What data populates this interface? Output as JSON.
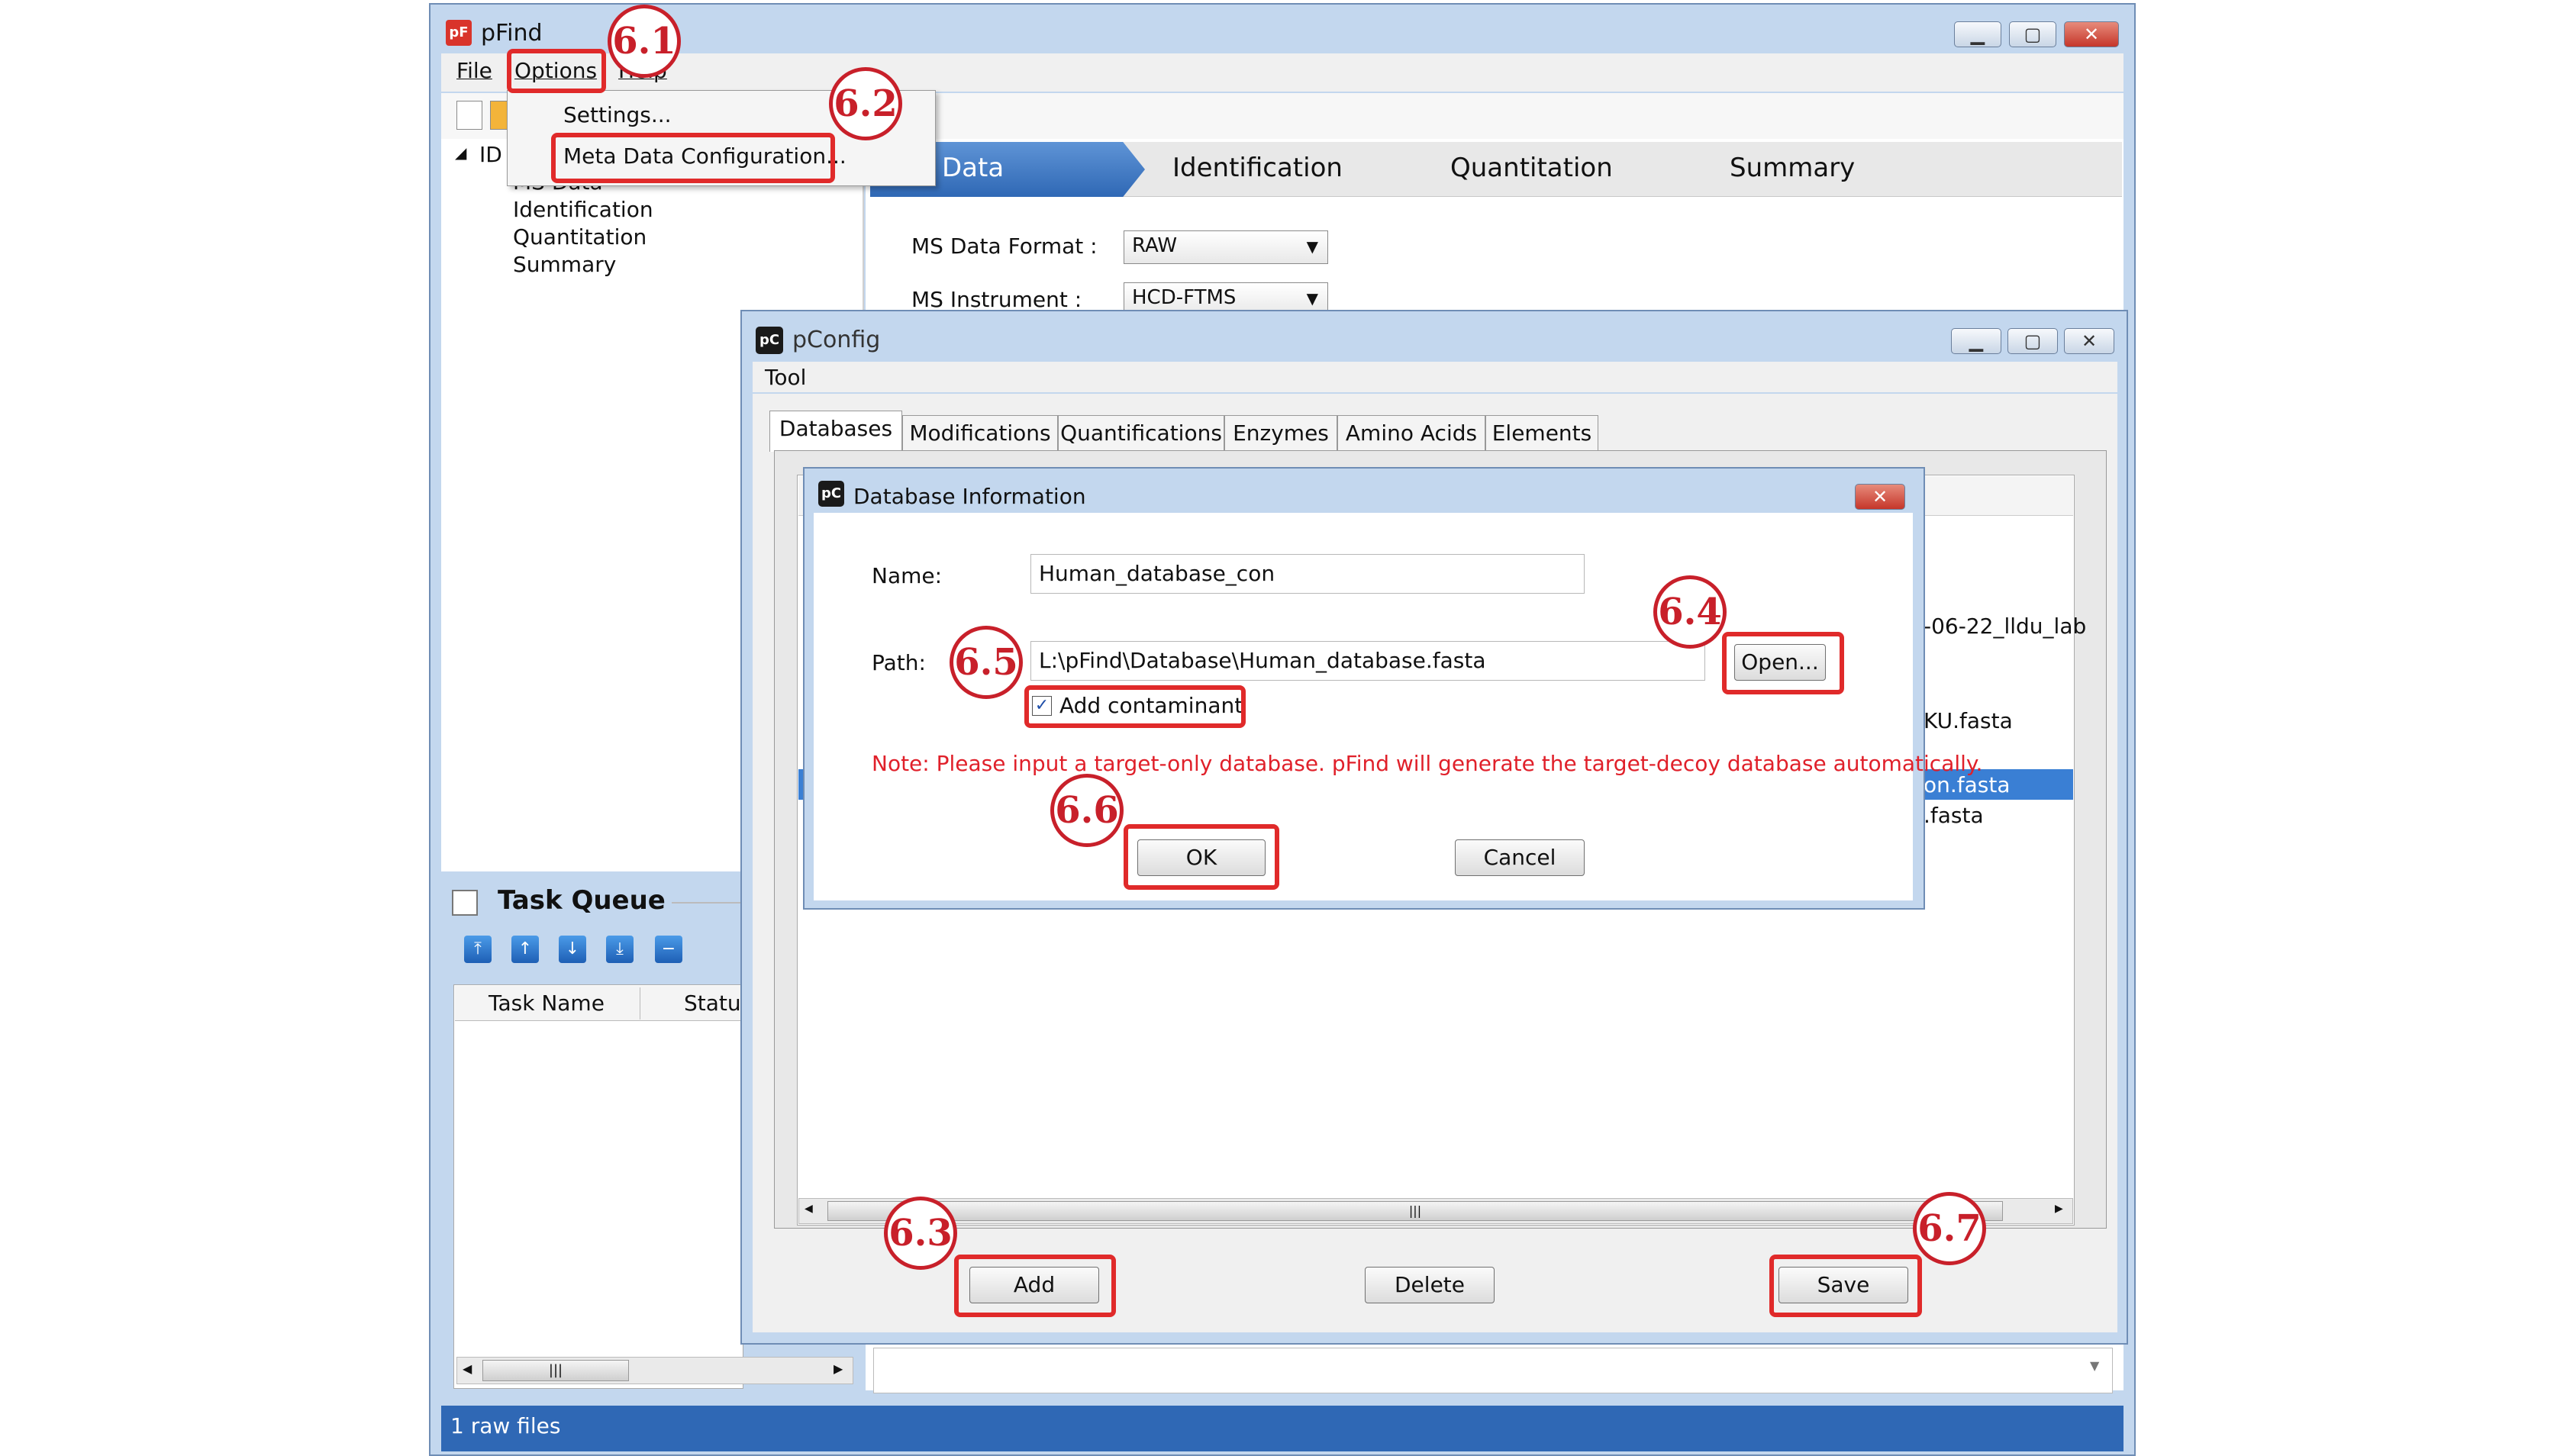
{
  "pfind": {
    "title": "pFind",
    "logo_text": "pF",
    "menu": {
      "file": "File",
      "options": "Options",
      "help": "Help"
    },
    "options_menu": {
      "settings": "Settings...",
      "meta_data": "Meta Data Configuration..."
    },
    "tree": {
      "root": "ID",
      "items": [
        "MS Data",
        "Identification",
        "Quantitation",
        "Summary"
      ]
    },
    "tabs": [
      "Data",
      "Identification",
      "Quantitation",
      "Summary"
    ],
    "form": {
      "ms_data_format_label": "MS Data Format :",
      "ms_data_format_value": "RAW",
      "ms_instrument_label": "MS Instrument :",
      "ms_instrument_value": "HCD-FTMS"
    },
    "task_queue": {
      "title": "Task Queue",
      "col_task_name": "Task Name",
      "col_status": "Statu"
    },
    "status": "1 raw files"
  },
  "pconfig": {
    "title": "pConfig",
    "logo_text": "pC",
    "menu_tool": "Tool",
    "tabs": [
      "Databases",
      "Modifications",
      "Quantifications",
      "Enzymes",
      "Amino Acids",
      "Elements"
    ],
    "list_fragments": [
      "-06-22_lldu_lab",
      "KU.fasta",
      "on.fasta",
      ".fasta"
    ],
    "buttons": {
      "add": "Add",
      "delete": "Delete",
      "save": "Save"
    }
  },
  "db_info": {
    "title": "Database Information",
    "name_label": "Name:",
    "name_value": "Human_database_con",
    "path_label": "Path:",
    "path_value": "L:\\pFind\\Database\\Human_database.fasta",
    "open_button": "Open...",
    "add_contaminant": "Add contaminant",
    "note": "Note: Please input a target-only database. pFind will generate the target-decoy database automatically.",
    "ok_button": "OK",
    "cancel_button": "Cancel"
  },
  "callouts": [
    "6.1",
    "6.2",
    "6.3",
    "6.4",
    "6.5",
    "6.6",
    "6.7"
  ],
  "colors": {
    "highlight": "#e02a2a",
    "active_tab": "#2f68b5",
    "note_text": "#e0202a",
    "selection": "#3a7fd4"
  }
}
